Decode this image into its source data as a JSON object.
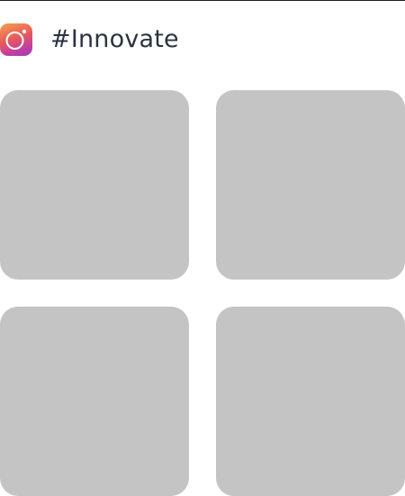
{
  "header": {
    "icon": "instagram-icon",
    "title": "#Innovate",
    "accent_colors": [
      "#f6a04d",
      "#e85a5a",
      "#c23f9f",
      "#9b3fbf"
    ]
  },
  "grid": {
    "tile_color": "#c4c4c4",
    "tiles": [
      {
        "name": "tile-1"
      },
      {
        "name": "tile-2"
      },
      {
        "name": "tile-3"
      },
      {
        "name": "tile-4"
      }
    ]
  }
}
